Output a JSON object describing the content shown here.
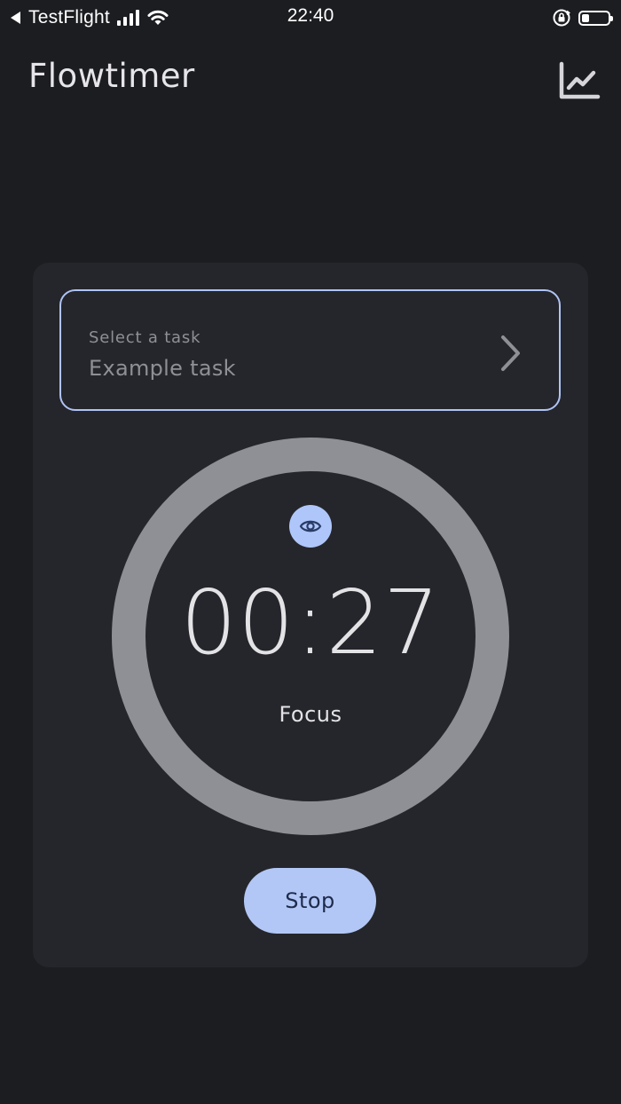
{
  "status_bar": {
    "back_app": "TestFlight",
    "time": "22:40",
    "battery_level": 0.3
  },
  "app_bar": {
    "title": "Flowtimer",
    "stats_icon": "trending-chart-icon"
  },
  "task_selector": {
    "label": "Select a task",
    "value": "Example task",
    "chevron_icon": "chevron-right-icon"
  },
  "timer": {
    "time": "00:27",
    "mode": "Focus",
    "toggle_icon": "eye-icon"
  },
  "actions": {
    "stop_label": "Stop"
  },
  "colors": {
    "background": "#1c1d21",
    "card": "#25262b",
    "accent": "#b3c7f6",
    "ring": "#8e9095"
  }
}
